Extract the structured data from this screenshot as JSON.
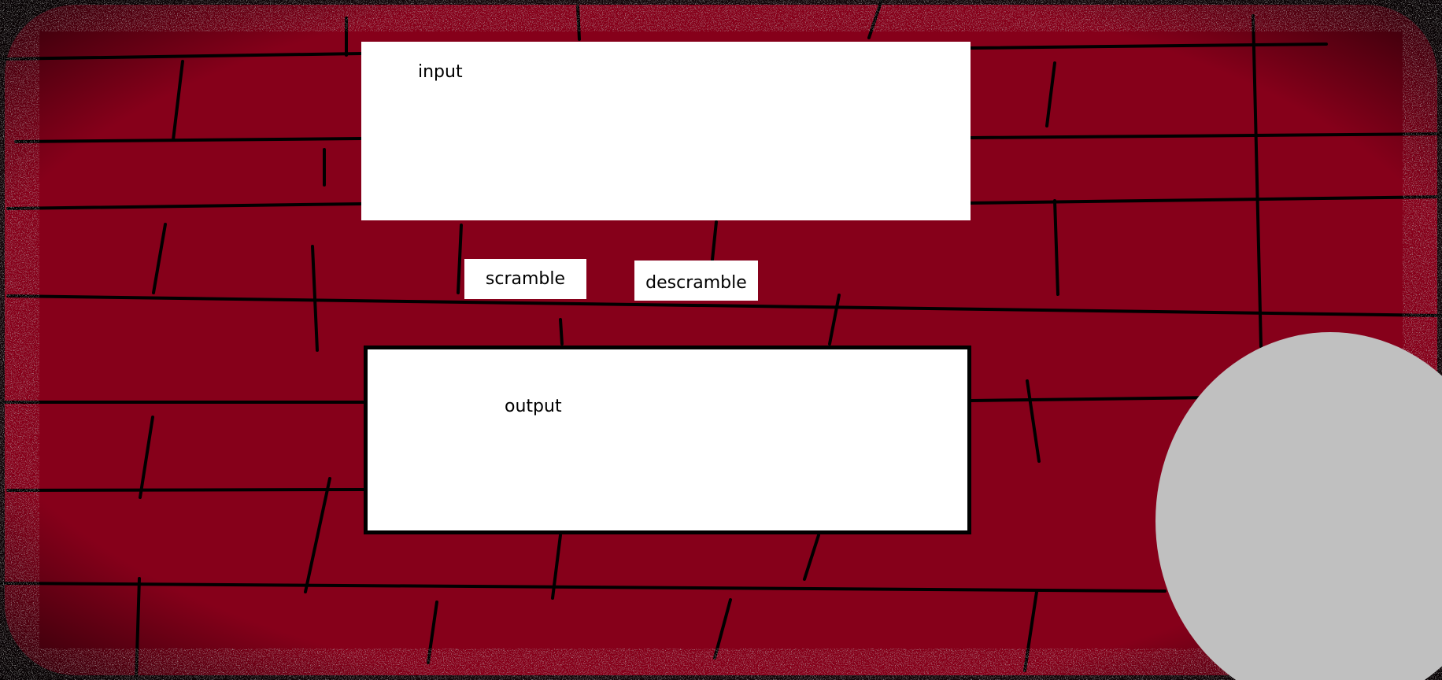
{
  "app": {
    "input_panel": {
      "label": "input"
    },
    "output_panel": {
      "label": "output"
    },
    "buttons": {
      "scramble_label": "scramble",
      "descramble_label": "descramble"
    },
    "theme": {
      "wall_color": "#86001a",
      "mortar_color": "#000000",
      "panel_color": "#ffffff",
      "orb_color": "#c0c0c0"
    },
    "decorations": [
      "brick-wall",
      "gray-orb"
    ]
  }
}
